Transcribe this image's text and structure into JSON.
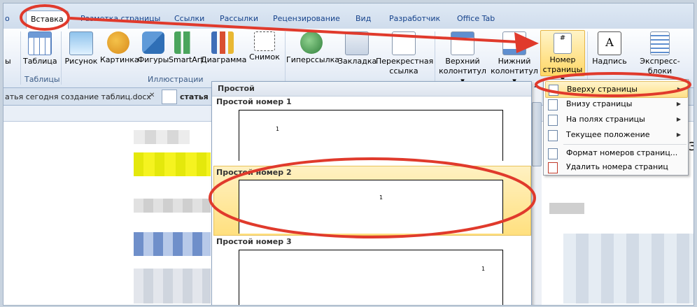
{
  "ribbon_tabs": [
    "о",
    "Вставка",
    "Разметка страницы",
    "Ссылки",
    "Рассылки",
    "Рецензирование",
    "Вид",
    "Разработчик",
    "Office Tab"
  ],
  "ribbon": {
    "buttons": [
      {
        "label": "Таблица"
      },
      {
        "label": "Рисунок"
      },
      {
        "label": "Картинка"
      },
      {
        "label": "Фигуры"
      },
      {
        "label": "SmartArt"
      },
      {
        "label": "Диаграмма"
      },
      {
        "label": "Снимок"
      },
      {
        "label": "Гиперссылка"
      },
      {
        "label": "Закладка"
      },
      {
        "label": "Перекрестная",
        "label2": "ссылка"
      },
      {
        "label": "Верхний",
        "label2": "колонтитул"
      },
      {
        "label": "Нижний",
        "label2": "колонтитул"
      },
      {
        "label": "Номер",
        "label2": "страницы"
      },
      {
        "label": "Надпись"
      },
      {
        "label": "Экспресс-блоки"
      }
    ],
    "groups": {
      "tables": "Таблицы",
      "illustrations": "Иллюстрации"
    }
  },
  "doc_tabs": [
    "атья сегодня создание таблиц.docx",
    "статья"
  ],
  "gallery": {
    "header": "Простой",
    "items": [
      {
        "label": "Простой номер 1",
        "num": "1"
      },
      {
        "label": "Простой номер 2",
        "num": "1"
      },
      {
        "label": "Простой номер 3",
        "num": "1"
      }
    ]
  },
  "page_number_menu": [
    {
      "label": "Вверху страницы",
      "arrow": "▶"
    },
    {
      "label": "Внизу страницы",
      "arrow": "▶"
    },
    {
      "label": "На полях страницы",
      "arrow": "▶"
    },
    {
      "label": "Текущее положение",
      "arrow": "▶"
    },
    {
      "label": "Формат номеров страниц..."
    },
    {
      "label": "Удалить номера страниц"
    }
  ],
  "edge_text": {
    "left": "ы",
    "right": "аз"
  },
  "colors": {
    "annotation_red": "#e03a2c",
    "highlight": "#ffe07f",
    "ribbon_text": "#15428b"
  }
}
